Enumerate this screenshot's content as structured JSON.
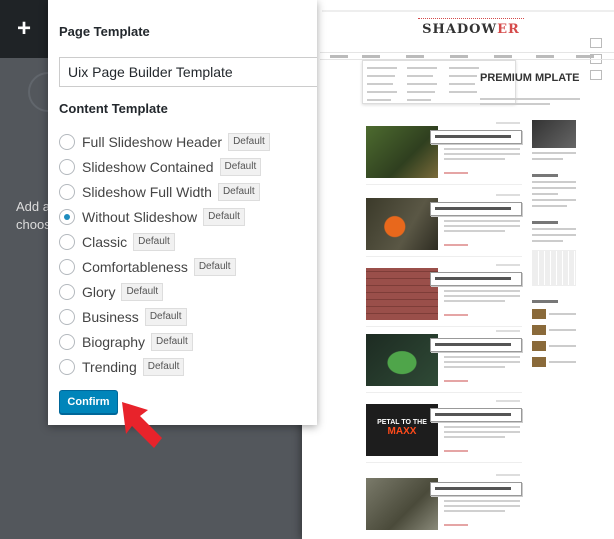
{
  "toolbar": {
    "add_icon": "+"
  },
  "modal": {
    "page_template_label": "Page Template",
    "page_template_value": "Uix Page Builder Template",
    "content_template_label": "Content Template",
    "options": [
      {
        "label": "Full Slideshow Header",
        "badge": "Default",
        "checked": false
      },
      {
        "label": "Slideshow Contained",
        "badge": "Default",
        "checked": false
      },
      {
        "label": "Slideshow Full Width",
        "badge": "Default",
        "checked": false
      },
      {
        "label": "Without Slideshow",
        "badge": "Default",
        "checked": true
      },
      {
        "label": "Classic",
        "badge": "Default",
        "checked": false
      },
      {
        "label": "Comfortableness",
        "badge": "Default",
        "checked": false
      },
      {
        "label": "Glory",
        "badge": "Default",
        "checked": false
      },
      {
        "label": "Business",
        "badge": "Default",
        "checked": false
      },
      {
        "label": "Biography",
        "badge": "Default",
        "checked": false
      },
      {
        "label": "Trending",
        "badge": "Default",
        "checked": false
      }
    ],
    "confirm_label": "Confirm"
  },
  "background": {
    "text_line_1": "Add a",
    "text_line_2": "choos"
  },
  "preview": {
    "logo_main": "SHADOW",
    "logo_accent": "ER",
    "hero_title": "PREMIUM MPLATE",
    "video_text_line_1": "PETAL TO THE",
    "video_text_line_2": "MAXX"
  },
  "colors": {
    "accent": "#0085ba",
    "arrow": "#e8232b",
    "logo_accent": "#d54b4b"
  }
}
